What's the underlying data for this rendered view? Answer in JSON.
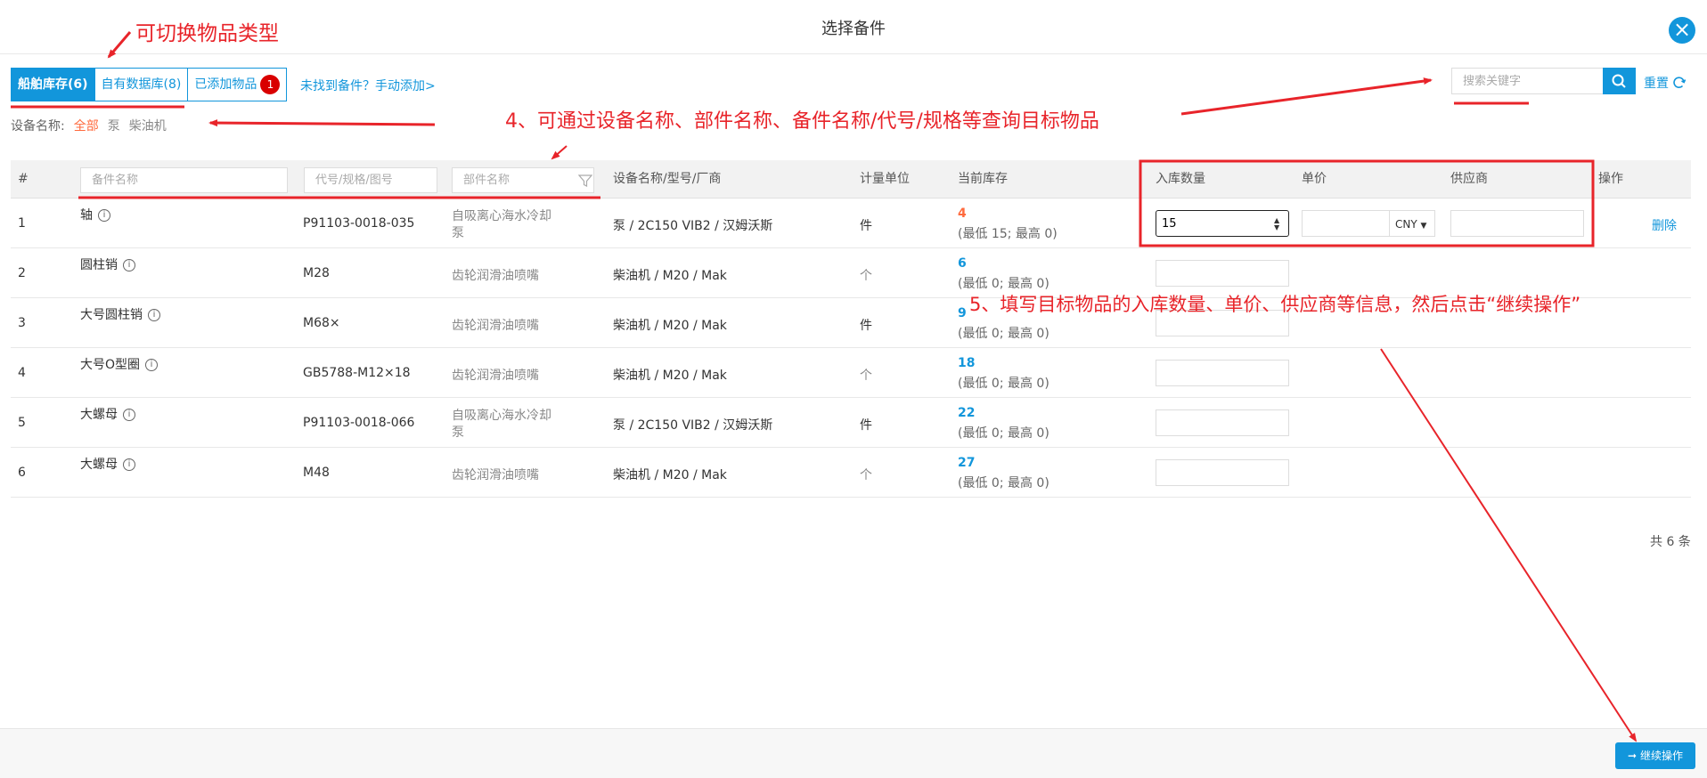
{
  "modal": {
    "title": "选择备件",
    "close_icon": "close-icon"
  },
  "tabs": [
    {
      "label": "船舶库存(6)",
      "active": true
    },
    {
      "label": "自有数据库(8)",
      "active": false
    },
    {
      "label": "已添加物品",
      "active": false,
      "badge": "1"
    }
  ],
  "manual_link": "未找到备件？手动添加>",
  "search": {
    "placeholder": "搜索关键字",
    "icon": "search-icon",
    "reset_label": "重置",
    "reset_icon": "refresh-icon"
  },
  "equipment_filter": {
    "label": "设备名称:",
    "options": [
      "全部",
      "泵",
      "柴油机"
    ],
    "active": "全部"
  },
  "table": {
    "headers": {
      "index": "#",
      "part_name_placeholder": "备件名称",
      "code_placeholder": "代号/规格/图号",
      "component_placeholder": "部件名称",
      "equipment": "设备名称/型号/厂商",
      "unit": "计量单位",
      "stock": "当前库存",
      "quantity": "入库数量",
      "price": "单价",
      "supplier": "供应商",
      "action": "操作"
    },
    "rows": [
      {
        "index": "1",
        "name": "轴",
        "code": "P91103-0018-035",
        "component_line1": "自吸离心海水冷却",
        "component_line2": "泵",
        "equipment": "泵 / 2C150 VIB2 / 汉姆沃斯",
        "unit": "件",
        "stock": "4",
        "stock_range": "(最低 15; 最高 0)",
        "quantity": "15",
        "currency": "CNY",
        "action": "删除"
      },
      {
        "index": "2",
        "name": "圆柱销",
        "code": "M28",
        "component_line1": "齿轮润滑油喷嘴",
        "component_line2": "",
        "equipment": "柴油机 / M20 / Mak",
        "unit": "个",
        "stock": "6",
        "stock_range": "(最低 0; 最高 0)",
        "quantity": ""
      },
      {
        "index": "3",
        "name": "大号圆柱销",
        "code": "M68×",
        "component_line1": "齿轮润滑油喷嘴",
        "component_line2": "",
        "equipment": "柴油机 / M20 / Mak",
        "unit": "件",
        "stock": "9",
        "stock_range": "(最低 0; 最高 0)",
        "quantity": ""
      },
      {
        "index": "4",
        "name": "大号O型圈",
        "code": "GB5788-M12×18",
        "component_line1": "齿轮润滑油喷嘴",
        "component_line2": "",
        "equipment": "柴油机 / M20 / Mak",
        "unit": "个",
        "stock": "18",
        "stock_range": "(最低 0; 最高 0)",
        "quantity": ""
      },
      {
        "index": "5",
        "name": "大螺母",
        "code": "P91103-0018-066",
        "component_line1": "自吸离心海水冷却",
        "component_line2": "泵",
        "equipment": "泵 / 2C150 VIB2 / 汉姆沃斯",
        "unit": "件",
        "stock": "22",
        "stock_range": "(最低 0; 最高 0)",
        "quantity": ""
      },
      {
        "index": "6",
        "name": "大螺母",
        "code": "M48",
        "component_line1": "齿轮润滑油喷嘴",
        "component_line2": "",
        "equipment": "柴油机 / M20 / Mak",
        "unit": "个",
        "stock": "27",
        "stock_range": "(最低 0; 最高 0)",
        "quantity": ""
      }
    ],
    "total": "共 6 条"
  },
  "footer": {
    "continue_label": "继续操作",
    "continue_icon": "arrow-right-icon"
  },
  "annotations": {
    "switch_type": "可切换物品类型",
    "search_tip": "4、可通过设备名称、部件名称、备件名称/代号/规格等查询目标物品",
    "fill_tip": "5、填写目标物品的入库数量、单价、供应商等信息，然后点击“继续操作”"
  },
  "colors": {
    "accent": "#1296db",
    "annotation": "#e8242a",
    "low_stock": "#ff6a3d",
    "badge": "#d90000"
  }
}
